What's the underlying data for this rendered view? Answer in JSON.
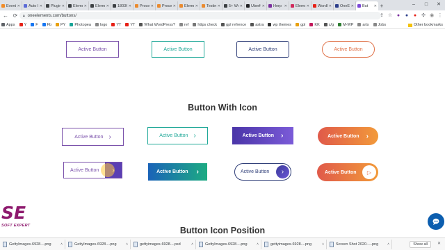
{
  "browser": {
    "tabs": [
      {
        "title": "Event",
        "color": "#f28b25"
      },
      {
        "title": "Auto I",
        "color": "#5b6bd6"
      },
      {
        "title": "Plugins",
        "color": "#3c4043"
      },
      {
        "title": "Elemen",
        "color": "#3c4043"
      },
      {
        "title": "Elemen",
        "color": "#3c4043"
      },
      {
        "title": "18036",
        "color": "#3c4043"
      },
      {
        "title": "Proces",
        "color": "#ea8a2e"
      },
      {
        "title": "Proces",
        "color": "#ea8a2e"
      },
      {
        "title": "Elemen",
        "color": "#ea8a2e"
      },
      {
        "title": "Testim",
        "color": "#ea8a2e"
      },
      {
        "title": "5+ Wo",
        "color": "#3c4043"
      },
      {
        "title": "Uberfo",
        "color": "#202124"
      },
      {
        "title": "Herp I",
        "color": "#7b2e9e"
      },
      {
        "title": "Elemen",
        "color": "#d02a5c"
      },
      {
        "title": "WordP",
        "color": "#e62117"
      },
      {
        "title": "OneEle",
        "color": "#2b3d8a"
      },
      {
        "title": "But",
        "color": "#7b47d8",
        "active": true
      }
    ],
    "new_tab_glyph": "+",
    "url": "oneelements.com/buttons/"
  },
  "bookmarks": {
    "items": [
      {
        "label": "Apps",
        "color": "#5f6368"
      },
      {
        "label": "Y",
        "color": "#e62117"
      },
      {
        "label": "F",
        "color": "#1877f2"
      },
      {
        "label": "Fb",
        "color": "#1877f2"
      },
      {
        "label": "PY",
        "color": "#e8a010"
      },
      {
        "label": "Photopea",
        "color": "#18a497"
      },
      {
        "label": "logo",
        "color": "#888"
      },
      {
        "label": "YT",
        "color": "#e62117"
      },
      {
        "label": "YT",
        "color": "#e62117"
      },
      {
        "label": "What WordPress?",
        "color": "#555"
      },
      {
        "label": "ref",
        "color": "#888"
      },
      {
        "label": "https check",
        "color": "#777"
      },
      {
        "label": "gpl refrence",
        "color": "#555"
      },
      {
        "label": "astra",
        "color": "#555"
      },
      {
        "label": "wp themes",
        "color": "#333"
      },
      {
        "label": "gpl",
        "color": "#e8a010"
      },
      {
        "label": "KK",
        "color": "#c2185b"
      },
      {
        "label": "c/g",
        "color": "#555"
      },
      {
        "label": "M-WP",
        "color": "#2e7d32"
      },
      {
        "label": "arts",
        "color": "#888"
      },
      {
        "label": "Jobs",
        "color": "#888"
      }
    ],
    "other": "Other bookmarks"
  },
  "page": {
    "top_row_buttons": [
      "Active Button",
      "Active Button",
      "Active Button",
      "Active Button"
    ],
    "section_title": "Button With Icon",
    "icon_row1": [
      "Active Button",
      "Active Button",
      "Active Button",
      "Active Button"
    ],
    "icon_row2": [
      "Active Button",
      "Active Button",
      "Active Button",
      "Active Button"
    ],
    "section_title_2": "Button Icon Position",
    "icon_glyph": "›",
    "play_glyph": "▷"
  },
  "colors": {
    "purple": "#7b52ab",
    "teal": "#1fa898",
    "navy": "#2f3e78",
    "orange": "#e0734a"
  },
  "logo": {
    "letters": "SE",
    "tagline": "SOFT EXPERT"
  },
  "downloads": {
    "items": [
      "GettyImages-6928....png",
      "GettyImages-6928....png",
      "gettyimages-6928....psd",
      "GettyImages-6928....png",
      "gettyimages-6928....png",
      "Screen Shot 2020-....png"
    ],
    "show_all": "Show all"
  }
}
